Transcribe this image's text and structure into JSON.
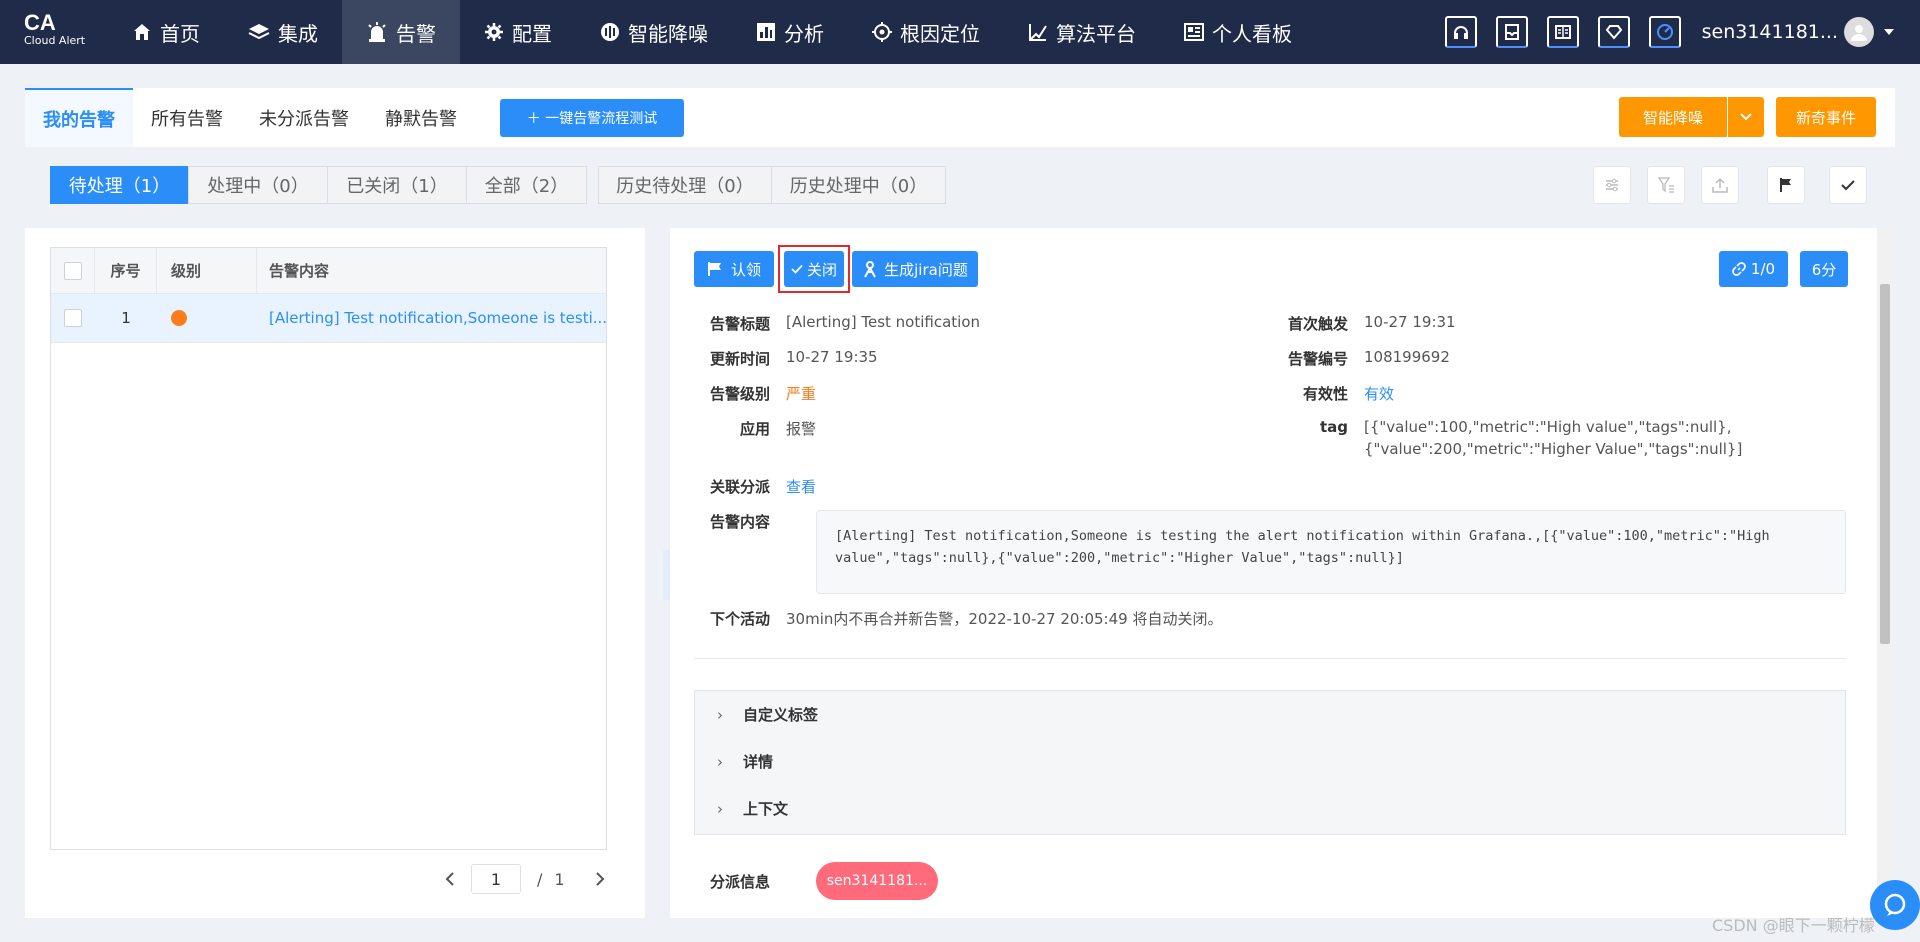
{
  "app": {
    "logo": "CA",
    "logo_sub": "Cloud Alert"
  },
  "nav": {
    "items": [
      {
        "label": "首页",
        "icon": "home-icon"
      },
      {
        "label": "集成",
        "icon": "layers-icon"
      },
      {
        "label": "告警",
        "icon": "alarm-icon",
        "active": true
      },
      {
        "label": "配置",
        "icon": "gear-icon"
      },
      {
        "label": "智能降噪",
        "icon": "noise-icon"
      },
      {
        "label": "分析",
        "icon": "bar-chart-icon"
      },
      {
        "label": "根因定位",
        "icon": "target-icon"
      },
      {
        "label": "算法平台",
        "icon": "algorithm-icon"
      },
      {
        "label": "个人看板",
        "icon": "dashboard-icon"
      }
    ],
    "user": "sen3141181..."
  },
  "tabs": {
    "items": [
      "我的告警",
      "所有告警",
      "未分派告警",
      "静默告警"
    ],
    "test_button": "＋  一键告警流程测试",
    "noise_button": "智能降噪",
    "new_event_button": "新奇事件"
  },
  "filters": {
    "items": [
      "待处理（1）",
      "处理中（0）",
      "已关闭（1）",
      "全部（2）"
    ],
    "history": [
      "历史待处理（0）",
      "历史处理中（0）"
    ]
  },
  "table": {
    "headers": [
      "序号",
      "级别",
      "告警内容"
    ],
    "rows": [
      {
        "index": "1",
        "level_color": "#fe7c1a",
        "content": "[Alerting] Test notification,Someone is testi..."
      }
    ],
    "pager": {
      "page": "1",
      "separator": "/",
      "total": "1"
    }
  },
  "detail": {
    "actions": {
      "claim": "认领",
      "close": "关闭",
      "jira": "生成jira问题",
      "link": "1/0",
      "time": "6分"
    },
    "fields": {
      "title_label": "告警标题",
      "title": "[Alerting] Test notification",
      "update_label": "更新时间",
      "update": "10-27 19:35",
      "level_label": "告警级别",
      "level": "严重",
      "app_label": "应用",
      "app": "报警",
      "first_label": "首次触发",
      "first": "10-27 19:31",
      "id_label": "告警编号",
      "id": "108199692",
      "valid_label": "有效性",
      "valid": "有效",
      "tag_label": "tag",
      "tag_line1": "[{\"value\":100,\"metric\":\"High value\",\"tags\":null},",
      "tag_line2": "{\"value\":200,\"metric\":\"Higher Value\",\"tags\":null}]",
      "assign_label": "关联分派",
      "assign": "查看",
      "content_label": "告警内容",
      "content_line1": "[Alerting] Test notification,Someone is testing the alert notification within Grafana.,[{\"value\":100,\"metric\":\"High",
      "content_line2": "value\",\"tags\":null},{\"value\":200,\"metric\":\"Higher Value\",\"tags\":null}]",
      "next_label": "下个活动",
      "next": "30min内不再合并新告警，2022-10-27 20:05:49 将自动关闭。"
    },
    "accordion": [
      "自定义标签",
      "详情",
      "上下文"
    ],
    "dispatch_label": "分派信息",
    "dispatch_user": "sen3141181..."
  },
  "watermark": "CSDN @眼下一颗柠檬",
  "colors": {
    "primary": "#2b8ef8",
    "orange": "#fe9700",
    "nav_bg": "#1f2b48",
    "danger": "#e0282f"
  }
}
